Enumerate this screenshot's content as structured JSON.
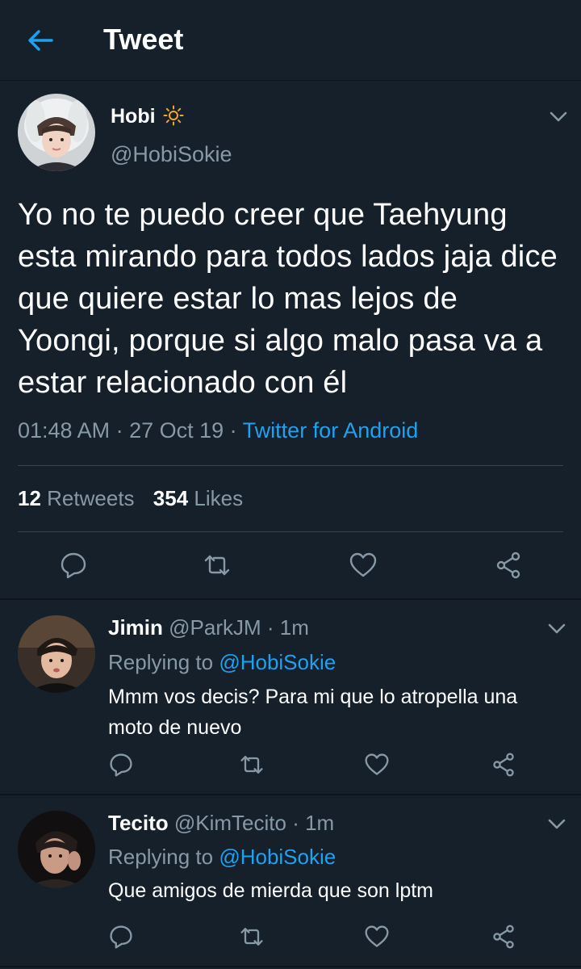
{
  "header": {
    "title": "Tweet",
    "back_icon": "arrow-left-icon"
  },
  "main_tweet": {
    "display_name": "Hobi",
    "name_emoji": "sun-icon",
    "handle": "@HobiSokie",
    "text": "Yo no te puedo creer que Taehyung esta mirando para todos lados jaja dice que quiere estar lo mas lejos de Yoongi, porque si algo malo pasa va a estar relacionado con él",
    "time": "01:48 AM",
    "date": "27 Oct 19",
    "source": "Twitter for Android",
    "retweets_count": "12",
    "retweets_label": "Retweets",
    "likes_count": "354",
    "likes_label": "Likes"
  },
  "replies": [
    {
      "display_name": "Jimin",
      "handle": "@ParkJM",
      "time": "1m",
      "replying_label": "Replying to",
      "replying_handle": "@HobiSokie",
      "text": "Mmm vos decis? Para mi que lo atropella una moto de nuevo"
    },
    {
      "display_name": "Tecito",
      "handle": "@KimTecito",
      "time": "1m",
      "replying_label": "Replying to",
      "replying_handle": "@HobiSokie",
      "text": "Que amigos de mierda que son lptm"
    }
  ],
  "colors": {
    "background": "#15202b",
    "accent": "#1da1f2",
    "muted": "#8899a6",
    "divider": "#38444d"
  }
}
